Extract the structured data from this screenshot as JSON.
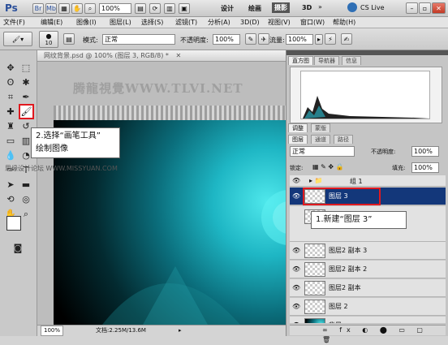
{
  "titlebar": {
    "logo": "Ps",
    "zoom": "100%",
    "workspace_buttons": [
      "设计",
      "绘画",
      "摄影"
    ],
    "three_d": "3D",
    "cslive": "CS Live"
  },
  "menu": [
    "文件(F)",
    "编辑(E)",
    "图像(I)",
    "图层(L)",
    "选择(S)",
    "滤镜(T)",
    "分析(A)",
    "3D(D)",
    "视图(V)",
    "窗口(W)",
    "帮助(H)"
  ],
  "options": {
    "brush_size": "10",
    "mode_label": "模式:",
    "mode_value": "正常",
    "opacity_label": "不透明度:",
    "opacity_value": "100%",
    "flow_label": "流量:",
    "flow_value": "100%"
  },
  "document": {
    "tab_title": "网纹背景.psd @ 100% (图层 3, RGB/8) *",
    "zoom": "100%",
    "doc_size": "文档:2.25M/13.6M"
  },
  "watermark": {
    "title": "腾龍視覺WWW.TLVI.NET",
    "sub": "思缘设计论坛 WWW.MISSYUAN.COM"
  },
  "callouts": {
    "brush_tip_line1": "2.选择“画笔工具”",
    "brush_tip_line2": "绘制图像",
    "new_layer_tip": "1.新建“图层 3”"
  },
  "panels": {
    "top_tabs": [
      "直方图",
      "导航器",
      "信息"
    ],
    "mid_tabs": [
      "调整",
      "蒙版"
    ],
    "layers_tabs": [
      "图层",
      "通道",
      "路径"
    ],
    "blend_mode": "正常",
    "opacity_label": "不透明度:",
    "opacity_value": "100%",
    "lock_label": "锁定:",
    "fill_label": "填充:",
    "fill_value": "100%",
    "layers": [
      "组 1",
      "图层 3",
      "",
      "图层2 副本 3",
      "图层2 副本 2",
      "图层2 副本",
      "图层 2",
      "背景"
    ]
  }
}
